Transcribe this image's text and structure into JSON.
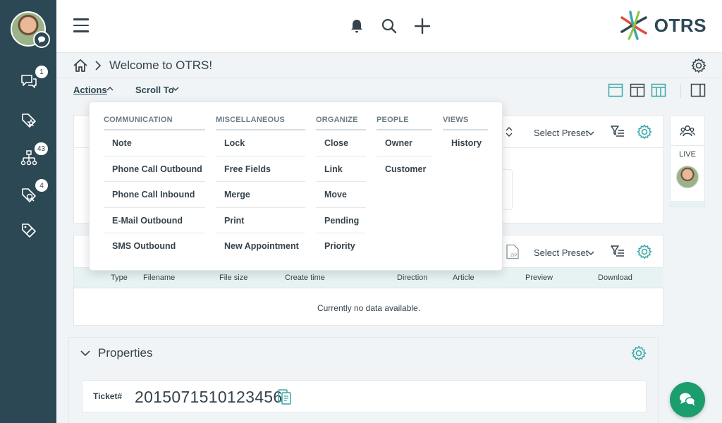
{
  "sidebar": {
    "items": [
      {
        "icon": "chat-bubbles-icon",
        "badge": "1"
      },
      {
        "icon": "star-tag-icon",
        "badge": ""
      },
      {
        "icon": "hierarchy-icon",
        "badge": "43"
      },
      {
        "icon": "search-tag-icon",
        "badge": "4"
      },
      {
        "icon": "edit-tag-icon",
        "badge": ""
      }
    ]
  },
  "topbar": {
    "logo_text": "OTRS"
  },
  "breadcrumb": {
    "title": "Welcome to OTRS!"
  },
  "actionsbar": {
    "actions_label": "Actions",
    "scroll_label": "Scroll To"
  },
  "widgets": {
    "preset_label": "Select Preset",
    "attachments_columns": [
      "Type",
      "Filename",
      "File size",
      "Create time",
      "Direction",
      "Article",
      "Preview",
      "Download"
    ],
    "no_data": "Currently no data available."
  },
  "properties": {
    "title": "Properties",
    "ticket_label": "Ticket#",
    "ticket_number": "2015071510123456"
  },
  "live_panel": {
    "label": "LIVE"
  },
  "dropdown": {
    "columns": [
      {
        "heading": "COMMUNICATION",
        "items": [
          "Note",
          "Phone Call Outbound",
          "Phone Call Inbound",
          "E-Mail Outbound",
          "SMS Outbound"
        ]
      },
      {
        "heading": "MISCELLANEOUS",
        "items": [
          "Lock",
          "Free Fields",
          "Merge",
          "Print",
          "New Appointment"
        ]
      },
      {
        "heading": "ORGANIZE",
        "items": [
          "Close",
          "Link",
          "Move",
          "Pending",
          "Priority"
        ]
      },
      {
        "heading": "PEOPLE",
        "items": [
          "Owner",
          "Customer"
        ]
      },
      {
        "heading": "VIEWS",
        "items": [
          "History"
        ]
      }
    ]
  },
  "colors": {
    "sidebar": "#2c4854",
    "accent": "#3aa8a8",
    "chat": "#1b9d6e"
  }
}
